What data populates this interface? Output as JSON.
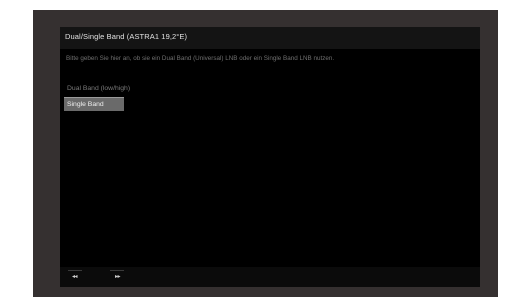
{
  "dialog": {
    "title": "Dual/Single Band (ASTRA1 19,2°E)",
    "instruction": "Bitte geben Sie hier an, ob sie ein Dual Band (Universal) LNB oder ein Single Band LNB nutzen.",
    "options": [
      {
        "label": "Dual Band (low/high)",
        "selected": false
      },
      {
        "label": "Single Band",
        "selected": true
      }
    ]
  },
  "footer": {
    "back_label": "◂◂",
    "forward_label": "▸▸"
  },
  "colors": {
    "frame": "#353030",
    "dialog_bg": "#000000",
    "selected_bg": "#6a6a6a"
  }
}
